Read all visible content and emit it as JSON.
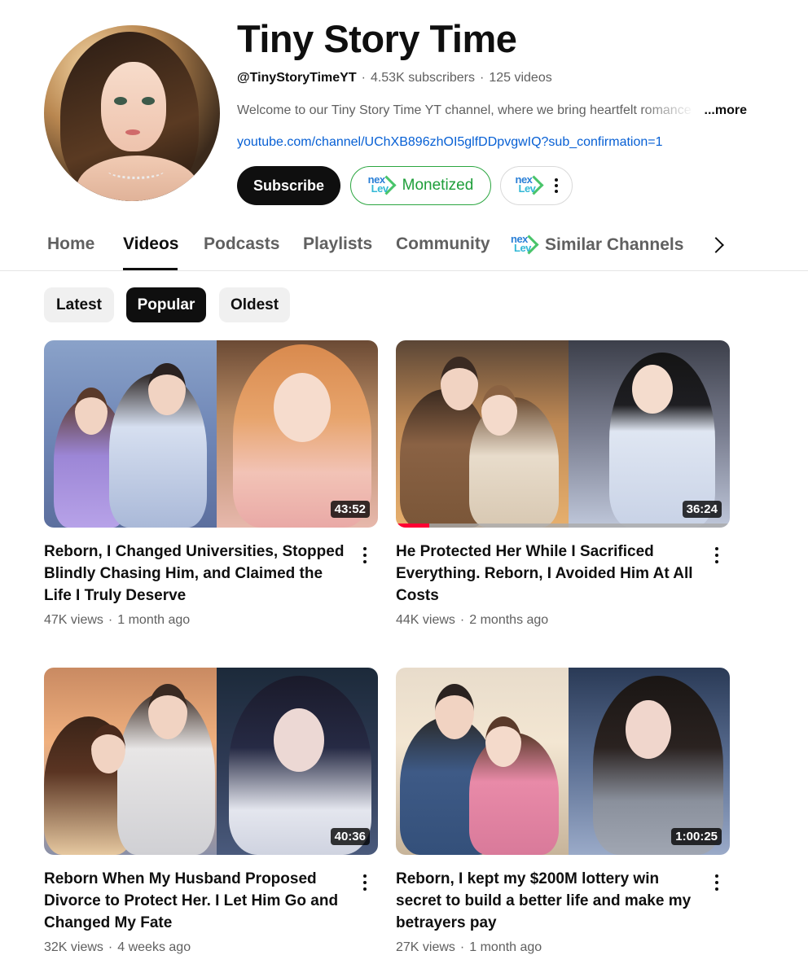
{
  "channel": {
    "title": "Tiny Story Time",
    "handle": "@TinyStoryTimeYT",
    "subscribers": "4.53K subscribers",
    "videos_count": "125 videos",
    "description": "Welcome to our Tiny Story Time YT channel, where we bring heartfelt romance stories",
    "more_label": "...more",
    "link": "youtube.com/channel/UChXB896zhOI5glfDDpvgwIQ?sub_confirmation=1"
  },
  "buttons": {
    "subscribe": "Subscribe",
    "monetized": "Monetized"
  },
  "nexlev_logo": {
    "top": "nex",
    "bottom": "Lev"
  },
  "tabs": [
    "Home",
    "Videos",
    "Podcasts",
    "Playlists",
    "Community",
    "Similar Channels"
  ],
  "active_tab": "Videos",
  "chips": [
    "Latest",
    "Popular",
    "Oldest"
  ],
  "active_chip": "Popular",
  "videos": [
    {
      "title": "Reborn, I Changed Universities, Stopped Blindly Chasing Him, and Claimed the Life I Truly Deserve",
      "views": "47K views",
      "age": "1 month ago",
      "duration": "43:52",
      "watched_fraction": 0
    },
    {
      "title": "He Protected Her While I Sacrificed Everything. Reborn, I Avoided Him At All Costs",
      "views": "44K views",
      "age": "2 months ago",
      "duration": "36:24",
      "watched_fraction": 0.1
    },
    {
      "title": "Reborn When My Husband Proposed Divorce to Protect Her. I Let Him Go and Changed My Fate",
      "views": "32K views",
      "age": "4 weeks ago",
      "duration": "40:36",
      "watched_fraction": 0
    },
    {
      "title": "Reborn, I kept my $200M lottery win secret to build a better life and make my betrayers pay",
      "views": "27K views",
      "age": "1 month ago",
      "duration": "1:00:25",
      "watched_fraction": 0
    }
  ],
  "colors": {
    "accent_link": "#065fd4",
    "monetized_green": "#2ba640",
    "progress_red": "#ff0033",
    "text_secondary": "#606060"
  }
}
